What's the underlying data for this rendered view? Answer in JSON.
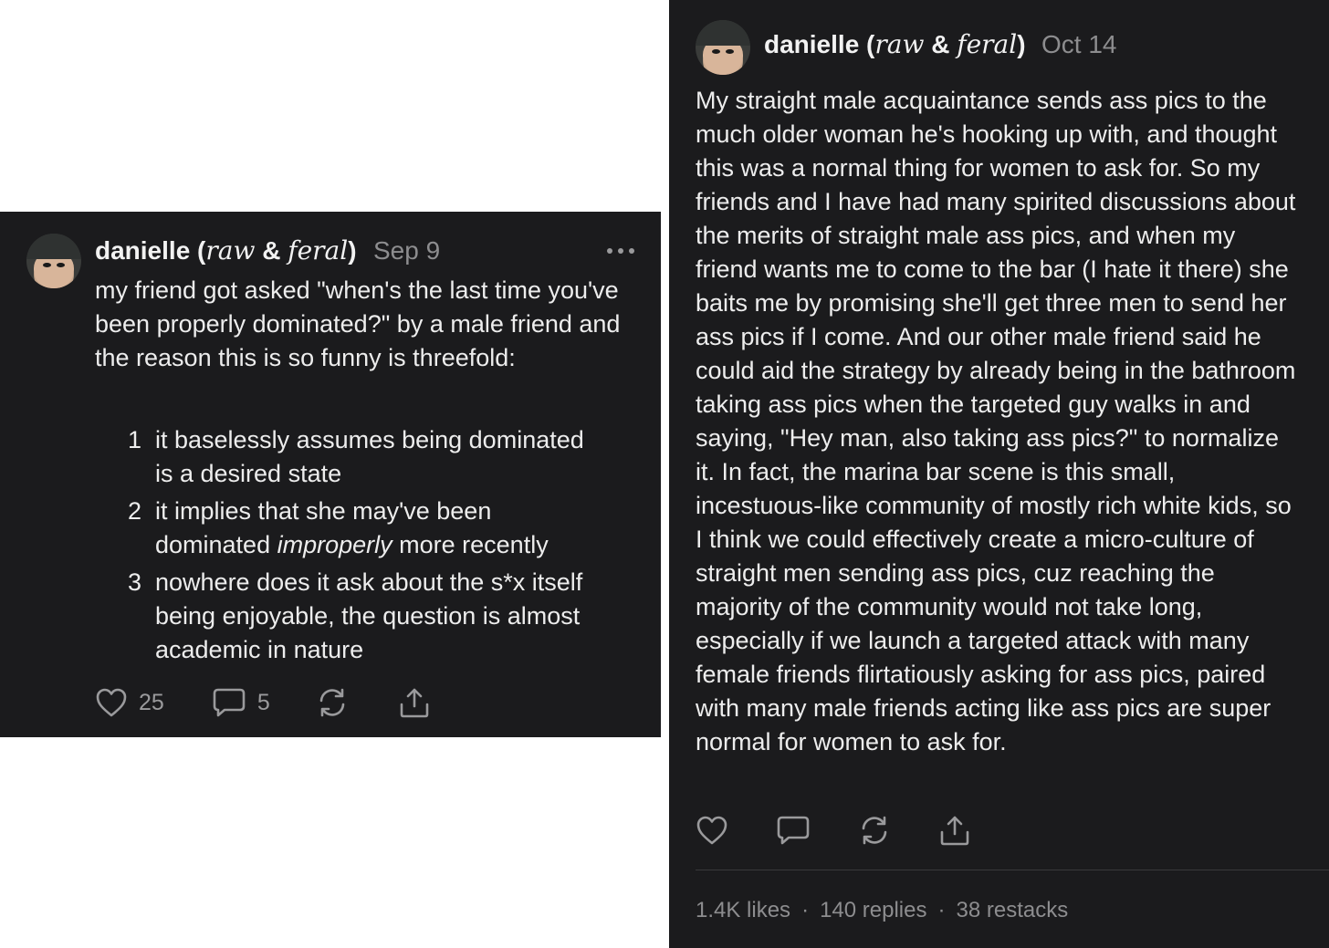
{
  "posts": [
    {
      "author_name": "danielle",
      "author_tag_open": "(",
      "author_tag_word1": "raw",
      "author_tag_amp": "&",
      "author_tag_word2": "feral",
      "author_tag_close": ")",
      "date": "Sep 9",
      "body": "my friend got asked \"when's the last time you've been properly dominated?\" by a male friend and the reason this is so funny is threefold:",
      "list": [
        {
          "num": "1",
          "text": "it baselessly assumes being dominated is a desired state"
        },
        {
          "num": "2",
          "pre": "it implies that she may've been dominated ",
          "em": "improperly",
          "post": " more recently"
        },
        {
          "num": "3",
          "text": "nowhere does it ask about the s*x itself being enjoyable, the question is almost academic in nature"
        }
      ],
      "likes": "25",
      "replies": "5",
      "icons": [
        "heart-icon",
        "comment-icon",
        "restack-icon",
        "share-icon",
        "more-icon"
      ]
    },
    {
      "author_name": "danielle",
      "author_tag_open": "(",
      "author_tag_word1": "raw",
      "author_tag_amp": "&",
      "author_tag_word2": "feral",
      "author_tag_close": ")",
      "date": "Oct 14",
      "body": "My straight male acquaintance sends ass pics to the much older woman he's hooking up with, and thought this was a normal thing for women to ask for. So my friends and I have had many spirited discussions about the merits of straight male ass pics, and when my friend wants me to come to the bar (I hate it there) she baits me by promising she'll get three men to send her ass pics if I come. And our other male friend said he could aid the strategy by already being in the bathroom taking ass pics when the targeted guy walks in and saying, \"Hey man, also taking ass pics?\" to normalize it. In fact, the marina bar scene is this small, incestuous-like community of mostly rich white kids, so I think we could effectively create a micro-culture of straight men sending ass pics, cuz reaching the majority of the community would not take long, especially if we launch a targeted attack with many female friends flirtatiously asking for ass pics, paired with many male friends acting like ass pics are super normal for women to ask for.",
      "stats": {
        "likes": "1.4K likes",
        "separator": "·",
        "replies": "140 replies",
        "restacks": "38 restacks"
      },
      "icons": [
        "heart-icon",
        "comment-icon",
        "restack-icon",
        "share-icon"
      ]
    }
  ],
  "colors": {
    "card_bg": "#1b1b1d",
    "text": "#ededed",
    "muted": "#8d8d8f",
    "page_bg": "#ffffff"
  }
}
